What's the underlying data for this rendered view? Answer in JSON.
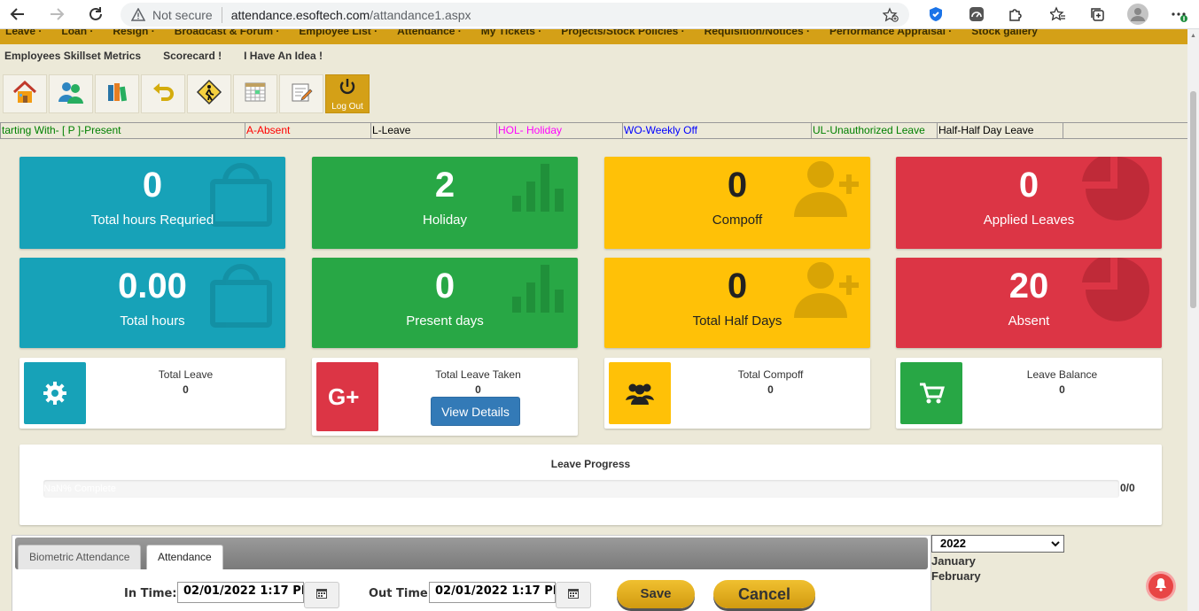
{
  "browser": {
    "security": "Not secure",
    "url_host": "attendance.esoftech.com",
    "url_path": "/attandance1.aspx"
  },
  "top_menu": [
    "Leave",
    "Loan",
    "Resign",
    "Broadcast & Forum",
    "Employee List",
    "Attendance",
    "My Tickets",
    "Projects/Stock Policies",
    "Requisition/Notices",
    "Performance Appraisal",
    "Stock gallery"
  ],
  "sub_menu": [
    "Employees Skillset Metrics",
    "Scorecard !",
    "I Have An Idea !"
  ],
  "toolbar": {
    "logout_label": "Log Out",
    "icons": [
      "home-icon",
      "users-icon",
      "books-icon",
      "undo-icon",
      "pedestrian-sign-icon",
      "calendar-grid-icon",
      "edit-icon",
      "power-icon"
    ]
  },
  "legend": [
    "tarting With- [ P ]-Present",
    "A-Absent",
    "L-Leave",
    "HOL- Holiday",
    "WO-Weekly Off",
    "UL-Unauthorized Leave",
    "Half-Half Day Leave",
    ""
  ],
  "legend_colors": [
    "#008000",
    "#ff0000",
    "#000000",
    "#ff00ff",
    "#0000ff",
    "#008000",
    "#000000",
    "#000000"
  ],
  "stats_row1": [
    {
      "value": "0",
      "label": "Total hours Requried",
      "color": "#17a2b8",
      "icon": "shopping-bag-icon"
    },
    {
      "value": "2",
      "label": "Holiday",
      "color": "#28a745",
      "icon": "bar-chart-icon"
    },
    {
      "value": "0",
      "label": "Compoff",
      "color": "#ffc107",
      "icon": "user-plus-icon"
    },
    {
      "value": "0",
      "label": "Applied Leaves",
      "color": "#dc3545",
      "icon": "pie-chart-icon"
    }
  ],
  "stats_row2": [
    {
      "value": "0.00",
      "label": "Total hours",
      "color": "#17a2b8",
      "icon": "shopping-bag-icon"
    },
    {
      "value": "0",
      "label": "Present days",
      "color": "#28a745",
      "icon": "bar-chart-icon"
    },
    {
      "value": "0",
      "label": "Total Half Days",
      "color": "#ffc107",
      "icon": "user-plus-icon"
    },
    {
      "value": "20",
      "label": "Absent",
      "color": "#dc3545",
      "icon": "pie-chart-icon"
    }
  ],
  "info_boxes": [
    {
      "title": "Total Leave",
      "value": "0",
      "color": "#17a2b8",
      "icon": "gear-icon"
    },
    {
      "title": "Total Leave Taken",
      "value": "0",
      "color": "#dc3545",
      "icon": "google-plus-icon",
      "button": "View Details"
    },
    {
      "title": "Total Compoff",
      "value": "0",
      "color": "#ffc107",
      "icon": "users-icon"
    },
    {
      "title": "Leave Balance",
      "value": "0",
      "color": "#28a745",
      "icon": "cart-icon"
    }
  ],
  "progress": {
    "title": "Leave Progress",
    "text": "NaN% Complete",
    "fraction": "0/0",
    "percent": 0
  },
  "attendance": {
    "tabs": [
      "Biometric Attendance",
      "Attendance"
    ],
    "active_tab": "Attendance",
    "in_label": "In Time:",
    "in_value": "02/01/2022 1:17 PI",
    "out_label": "Out Time:",
    "out_value": "02/01/2022 1:17 PI",
    "save": "Save",
    "cancel": "Cancel"
  },
  "calendar": {
    "year": "2022",
    "months": [
      "January",
      "February"
    ]
  }
}
